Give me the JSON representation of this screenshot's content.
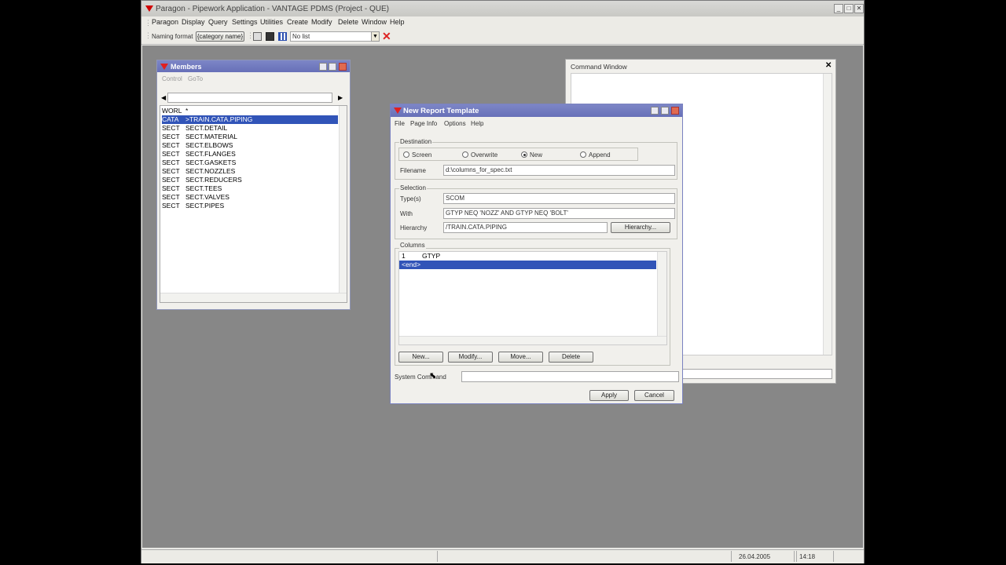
{
  "app": {
    "title": "Paragon - Pipework Application - VANTAGE PDMS (Project - QUE)",
    "menu": [
      "Paragon",
      "Display",
      "Query",
      "Settings",
      "Utilities",
      "Create",
      "Modify",
      "Delete",
      "Window",
      "Help"
    ],
    "toolbar": {
      "naming_format": "Naming format",
      "category": "{category name}",
      "list_value": "No list"
    },
    "status": {
      "date": "26.04.2005",
      "time": "14:18"
    }
  },
  "members": {
    "title": "Members",
    "menu": [
      "Control",
      "GoTo"
    ],
    "rows": [
      {
        "type": "WORL",
        "name": "*"
      },
      {
        "type": "CATA",
        "name": ">TRAIN.CATA.PIPING"
      },
      {
        "type": "SECT",
        "name": "SECT.DETAIL"
      },
      {
        "type": "SECT",
        "name": "SECT.MATERIAL"
      },
      {
        "type": "SECT",
        "name": "SECT.ELBOWS"
      },
      {
        "type": "SECT",
        "name": "SECT.FLANGES"
      },
      {
        "type": "SECT",
        "name": "SECT.GASKETS"
      },
      {
        "type": "SECT",
        "name": "SECT.NOZZLES"
      },
      {
        "type": "SECT",
        "name": "SECT.REDUCERS"
      },
      {
        "type": "SECT",
        "name": "SECT.TEES"
      },
      {
        "type": "SECT",
        "name": "SECT.VALVES"
      },
      {
        "type": "SECT",
        "name": "SECT.PIPES"
      }
    ]
  },
  "command_window": {
    "title": "Command Window"
  },
  "report": {
    "title": "New Report Template",
    "menu": [
      "File",
      "Page Info",
      "Options",
      "Help"
    ],
    "destination": {
      "label": "Destination",
      "options": [
        "Screen",
        "Overwrite",
        "New",
        "Append"
      ],
      "selected": "New",
      "filename_label": "Filename",
      "filename": "d:\\columns_for_spec.txt"
    },
    "selection": {
      "label": "Selection",
      "types_label": "Type(s)",
      "types": "SCOM",
      "with_label": "With",
      "with": "GTYP NEQ 'NOZZ' AND GTYP NEQ 'BOLT'",
      "hierarchy_label": "Hierarchy",
      "hierarchy": "/TRAIN.CATA.PIPING",
      "hierarchy_button": "Hierarchy..."
    },
    "columns": {
      "label": "Columns",
      "rows": [
        {
          "num": "1",
          "name": "GTYP"
        },
        {
          "num": "",
          "name": "<end>"
        }
      ],
      "buttons": [
        "New...",
        "Modify...",
        "Move...",
        "Delete"
      ]
    },
    "system_command_label": "System Command",
    "system_command": "",
    "apply": "Apply",
    "cancel": "Cancel"
  }
}
